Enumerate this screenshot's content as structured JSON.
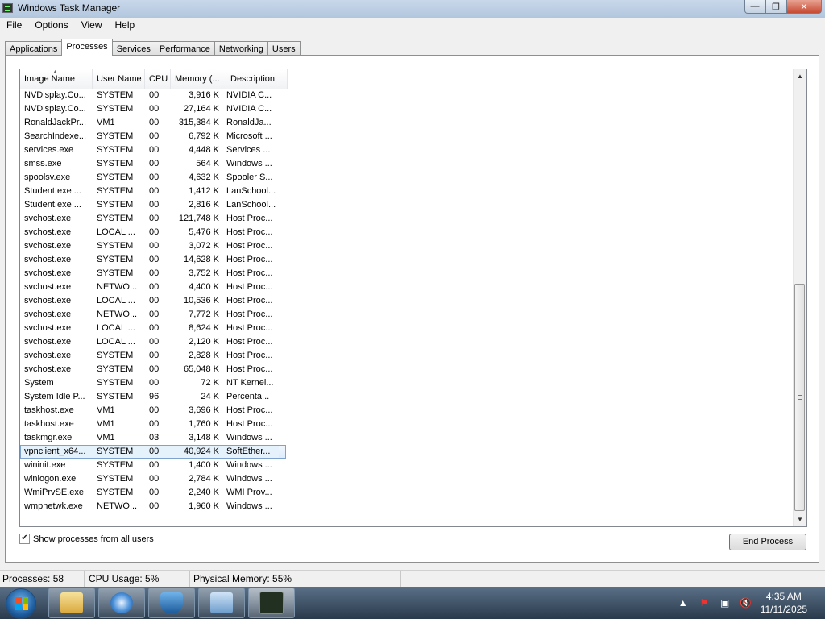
{
  "window": {
    "title": "Windows Task Manager"
  },
  "menu": [
    "File",
    "Options",
    "View",
    "Help"
  ],
  "tabs": [
    "Applications",
    "Processes",
    "Services",
    "Performance",
    "Networking",
    "Users"
  ],
  "active_tab": "Processes",
  "columns": [
    "Image Name",
    "User Name",
    "CPU",
    "Memory (...",
    "Description"
  ],
  "processes": [
    {
      "name": "NVDisplay.Co...",
      "user": "SYSTEM",
      "cpu": "00",
      "mem": "3,916 K",
      "desc": "NVIDIA C..."
    },
    {
      "name": "NVDisplay.Co...",
      "user": "SYSTEM",
      "cpu": "00",
      "mem": "27,164 K",
      "desc": "NVIDIA C..."
    },
    {
      "name": "RonaldJackPr...",
      "user": "VM1",
      "cpu": "00",
      "mem": "315,384 K",
      "desc": "RonaldJa..."
    },
    {
      "name": "SearchIndexe...",
      "user": "SYSTEM",
      "cpu": "00",
      "mem": "6,792 K",
      "desc": "Microsoft ..."
    },
    {
      "name": "services.exe",
      "user": "SYSTEM",
      "cpu": "00",
      "mem": "4,448 K",
      "desc": "Services ..."
    },
    {
      "name": "smss.exe",
      "user": "SYSTEM",
      "cpu": "00",
      "mem": "564 K",
      "desc": "Windows ..."
    },
    {
      "name": "spoolsv.exe",
      "user": "SYSTEM",
      "cpu": "00",
      "mem": "4,632 K",
      "desc": "Spooler S..."
    },
    {
      "name": "Student.exe ...",
      "user": "SYSTEM",
      "cpu": "00",
      "mem": "1,412 K",
      "desc": "LanSchool..."
    },
    {
      "name": "Student.exe ...",
      "user": "SYSTEM",
      "cpu": "00",
      "mem": "2,816 K",
      "desc": "LanSchool..."
    },
    {
      "name": "svchost.exe",
      "user": "SYSTEM",
      "cpu": "00",
      "mem": "121,748 K",
      "desc": "Host Proc..."
    },
    {
      "name": "svchost.exe",
      "user": "LOCAL ...",
      "cpu": "00",
      "mem": "5,476 K",
      "desc": "Host Proc..."
    },
    {
      "name": "svchost.exe",
      "user": "SYSTEM",
      "cpu": "00",
      "mem": "3,072 K",
      "desc": "Host Proc..."
    },
    {
      "name": "svchost.exe",
      "user": "SYSTEM",
      "cpu": "00",
      "mem": "14,628 K",
      "desc": "Host Proc..."
    },
    {
      "name": "svchost.exe",
      "user": "SYSTEM",
      "cpu": "00",
      "mem": "3,752 K",
      "desc": "Host Proc..."
    },
    {
      "name": "svchost.exe",
      "user": "NETWO...",
      "cpu": "00",
      "mem": "4,400 K",
      "desc": "Host Proc..."
    },
    {
      "name": "svchost.exe",
      "user": "LOCAL ...",
      "cpu": "00",
      "mem": "10,536 K",
      "desc": "Host Proc..."
    },
    {
      "name": "svchost.exe",
      "user": "NETWO...",
      "cpu": "00",
      "mem": "7,772 K",
      "desc": "Host Proc..."
    },
    {
      "name": "svchost.exe",
      "user": "LOCAL ...",
      "cpu": "00",
      "mem": "8,624 K",
      "desc": "Host Proc..."
    },
    {
      "name": "svchost.exe",
      "user": "LOCAL ...",
      "cpu": "00",
      "mem": "2,120 K",
      "desc": "Host Proc..."
    },
    {
      "name": "svchost.exe",
      "user": "SYSTEM",
      "cpu": "00",
      "mem": "2,828 K",
      "desc": "Host Proc..."
    },
    {
      "name": "svchost.exe",
      "user": "SYSTEM",
      "cpu": "00",
      "mem": "65,048 K",
      "desc": "Host Proc..."
    },
    {
      "name": "System",
      "user": "SYSTEM",
      "cpu": "00",
      "mem": "72 K",
      "desc": "NT Kernel..."
    },
    {
      "name": "System Idle P...",
      "user": "SYSTEM",
      "cpu": "96",
      "mem": "24 K",
      "desc": "Percenta..."
    },
    {
      "name": "taskhost.exe",
      "user": "VM1",
      "cpu": "00",
      "mem": "3,696 K",
      "desc": "Host Proc..."
    },
    {
      "name": "taskhost.exe",
      "user": "VM1",
      "cpu": "00",
      "mem": "1,760 K",
      "desc": "Host Proc..."
    },
    {
      "name": "taskmgr.exe",
      "user": "VM1",
      "cpu": "03",
      "mem": "3,148 K",
      "desc": "Windows ..."
    },
    {
      "name": "vpnclient_x64...",
      "user": "SYSTEM",
      "cpu": "00",
      "mem": "40,924 K",
      "desc": "SoftEther...",
      "selected": true
    },
    {
      "name": "wininit.exe",
      "user": "SYSTEM",
      "cpu": "00",
      "mem": "1,400 K",
      "desc": "Windows ..."
    },
    {
      "name": "winlogon.exe",
      "user": "SYSTEM",
      "cpu": "00",
      "mem": "2,784 K",
      "desc": "Windows ..."
    },
    {
      "name": "WmiPrvSE.exe",
      "user": "SYSTEM",
      "cpu": "00",
      "mem": "2,240 K",
      "desc": "WMI Prov..."
    },
    {
      "name": "wmpnetwk.exe",
      "user": "NETWO...",
      "cpu": "00",
      "mem": "1,960 K",
      "desc": "Windows ..."
    }
  ],
  "show_all_users": {
    "label": "Show processes from all users",
    "checked": true
  },
  "end_process_label": "End Process",
  "status": {
    "processes": "Processes: 58",
    "cpu": "CPU Usage: 5%",
    "memory": "Physical Memory: 55%"
  },
  "clock": {
    "time": "4:35 AM",
    "date": "11/11/2025"
  },
  "taskbar_apps": [
    "explorer-icon",
    "browser-icon",
    "security-shield-icon",
    "remote-desktop-icon",
    "task-manager-icon"
  ]
}
